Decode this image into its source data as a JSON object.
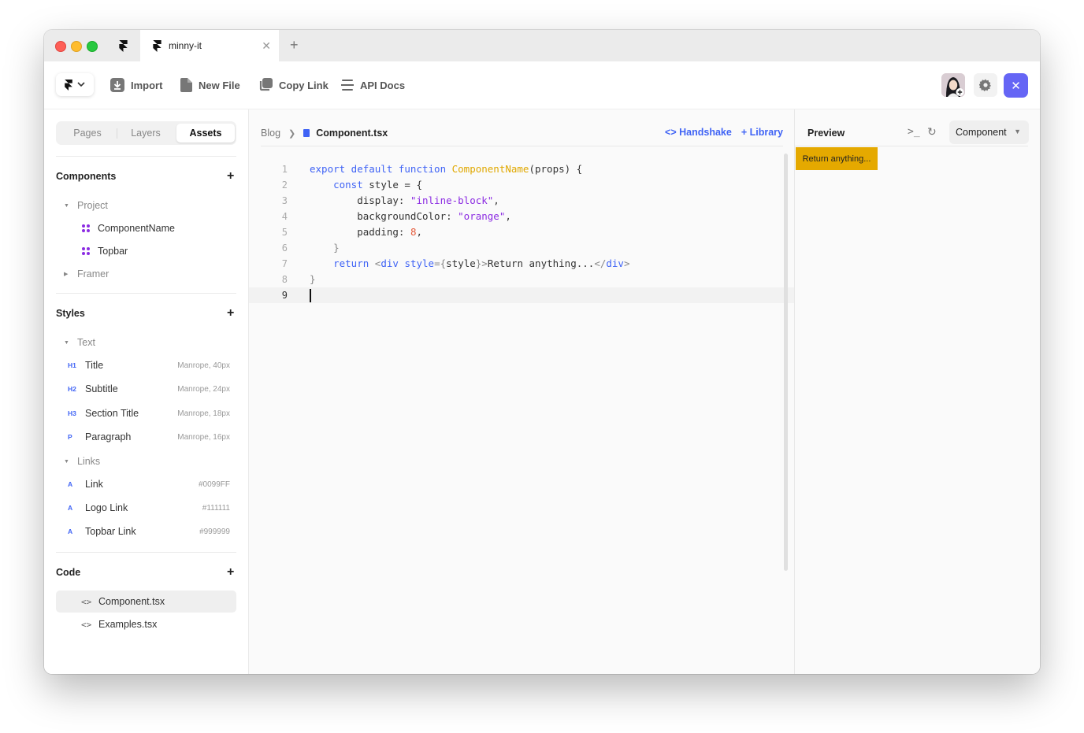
{
  "tab": {
    "title": "minny-it"
  },
  "toolbar": {
    "items": [
      {
        "label": "Import",
        "icon": "import-icon"
      },
      {
        "label": "New File",
        "icon": "file-icon"
      },
      {
        "label": "Copy Link",
        "icon": "copy-icon"
      },
      {
        "label": "API Docs",
        "icon": "menu-lines-icon"
      }
    ]
  },
  "sidebar": {
    "segments": [
      "Pages",
      "Layers",
      "Assets"
    ],
    "active_segment": "Assets",
    "components": {
      "heading": "Components",
      "folders": [
        {
          "label": "Project",
          "expanded": true,
          "items": [
            "ComponentName",
            "Topbar"
          ]
        },
        {
          "label": "Framer",
          "expanded": false,
          "items": []
        }
      ]
    },
    "styles": {
      "heading": "Styles",
      "text_group": "Text",
      "text_styles": [
        {
          "tag": "H1",
          "label": "Title",
          "meta": "Manrope, 40px"
        },
        {
          "tag": "H2",
          "label": "Subtitle",
          "meta": "Manrope, 24px"
        },
        {
          "tag": "H3",
          "label": "Section Title",
          "meta": "Manrope, 18px"
        },
        {
          "tag": "P",
          "label": "Paragraph",
          "meta": "Manrope, 16px"
        }
      ],
      "links_group": "Links",
      "link_styles": [
        {
          "tag": "A",
          "label": "Link",
          "meta": "#0099FF"
        },
        {
          "tag": "A",
          "label": "Logo Link",
          "meta": "#111111"
        },
        {
          "tag": "A",
          "label": "Topbar Link",
          "meta": "#999999"
        }
      ]
    },
    "code": {
      "heading": "Code",
      "files": [
        "Component.tsx",
        "Examples.tsx"
      ],
      "active_file": "Component.tsx"
    }
  },
  "editor": {
    "breadcrumb": [
      "Blog",
      "Component.tsx"
    ],
    "actions": {
      "handshake": "Handshake",
      "library": "Library"
    },
    "lines": [
      "export default function ComponentName(props) {",
      "    const style = {",
      "        display: \"inline-block\",",
      "        backgroundColor: \"orange\",",
      "        padding: 8,",
      "    }",
      "    return <div style={style}>Return anything...</div>",
      "}",
      ""
    ],
    "current_line": 9
  },
  "preview": {
    "title": "Preview",
    "select_value": "Component",
    "output_text": "Return anything..."
  },
  "colors": {
    "accent": "#3f63f5",
    "close_button": "#6565f5",
    "component_icon": "#8b2be2",
    "preview_box": "#e5a900"
  }
}
